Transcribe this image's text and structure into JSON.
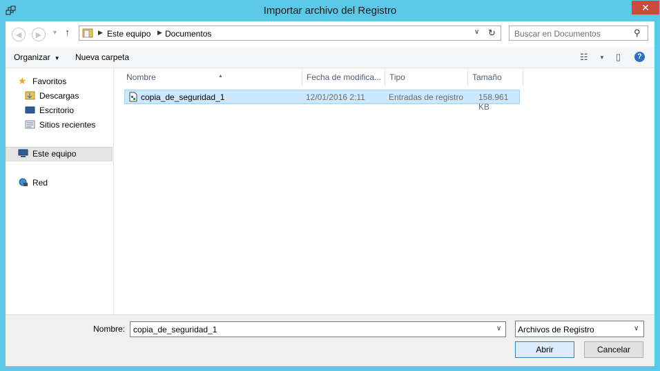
{
  "window": {
    "title": "Importar archivo del Registro",
    "close_glyph": "✕"
  },
  "address": {
    "breadcrumb": [
      "Este equipo",
      "Documentos"
    ],
    "search_placeholder": "Buscar en Documentos"
  },
  "toolbar": {
    "organize": "Organizar",
    "new_folder": "Nueva carpeta"
  },
  "nav": {
    "favorites": "Favoritos",
    "downloads": "Descargas",
    "desktop": "Escritorio",
    "recent": "Sitios recientes",
    "this_pc": "Este equipo",
    "network": "Red"
  },
  "columns": {
    "name": "Nombre",
    "date": "Fecha de modifica...",
    "type": "Tipo",
    "size": "Tamaño"
  },
  "files": [
    {
      "name": "copia_de_seguridad_1",
      "date": "12/01/2016 2:11",
      "type": "Entradas de registro",
      "size": "158.961 KB"
    }
  ],
  "footer": {
    "name_label": "Nombre:",
    "name_value": "copia_de_seguridad_1",
    "filter_value": "Archivos de Registro",
    "open_label": "Abrir",
    "cancel_label": "Cancelar"
  },
  "colors": {
    "frame": "#5bc8e8",
    "close": "#c74b3f",
    "selection": "#cce8ff"
  }
}
